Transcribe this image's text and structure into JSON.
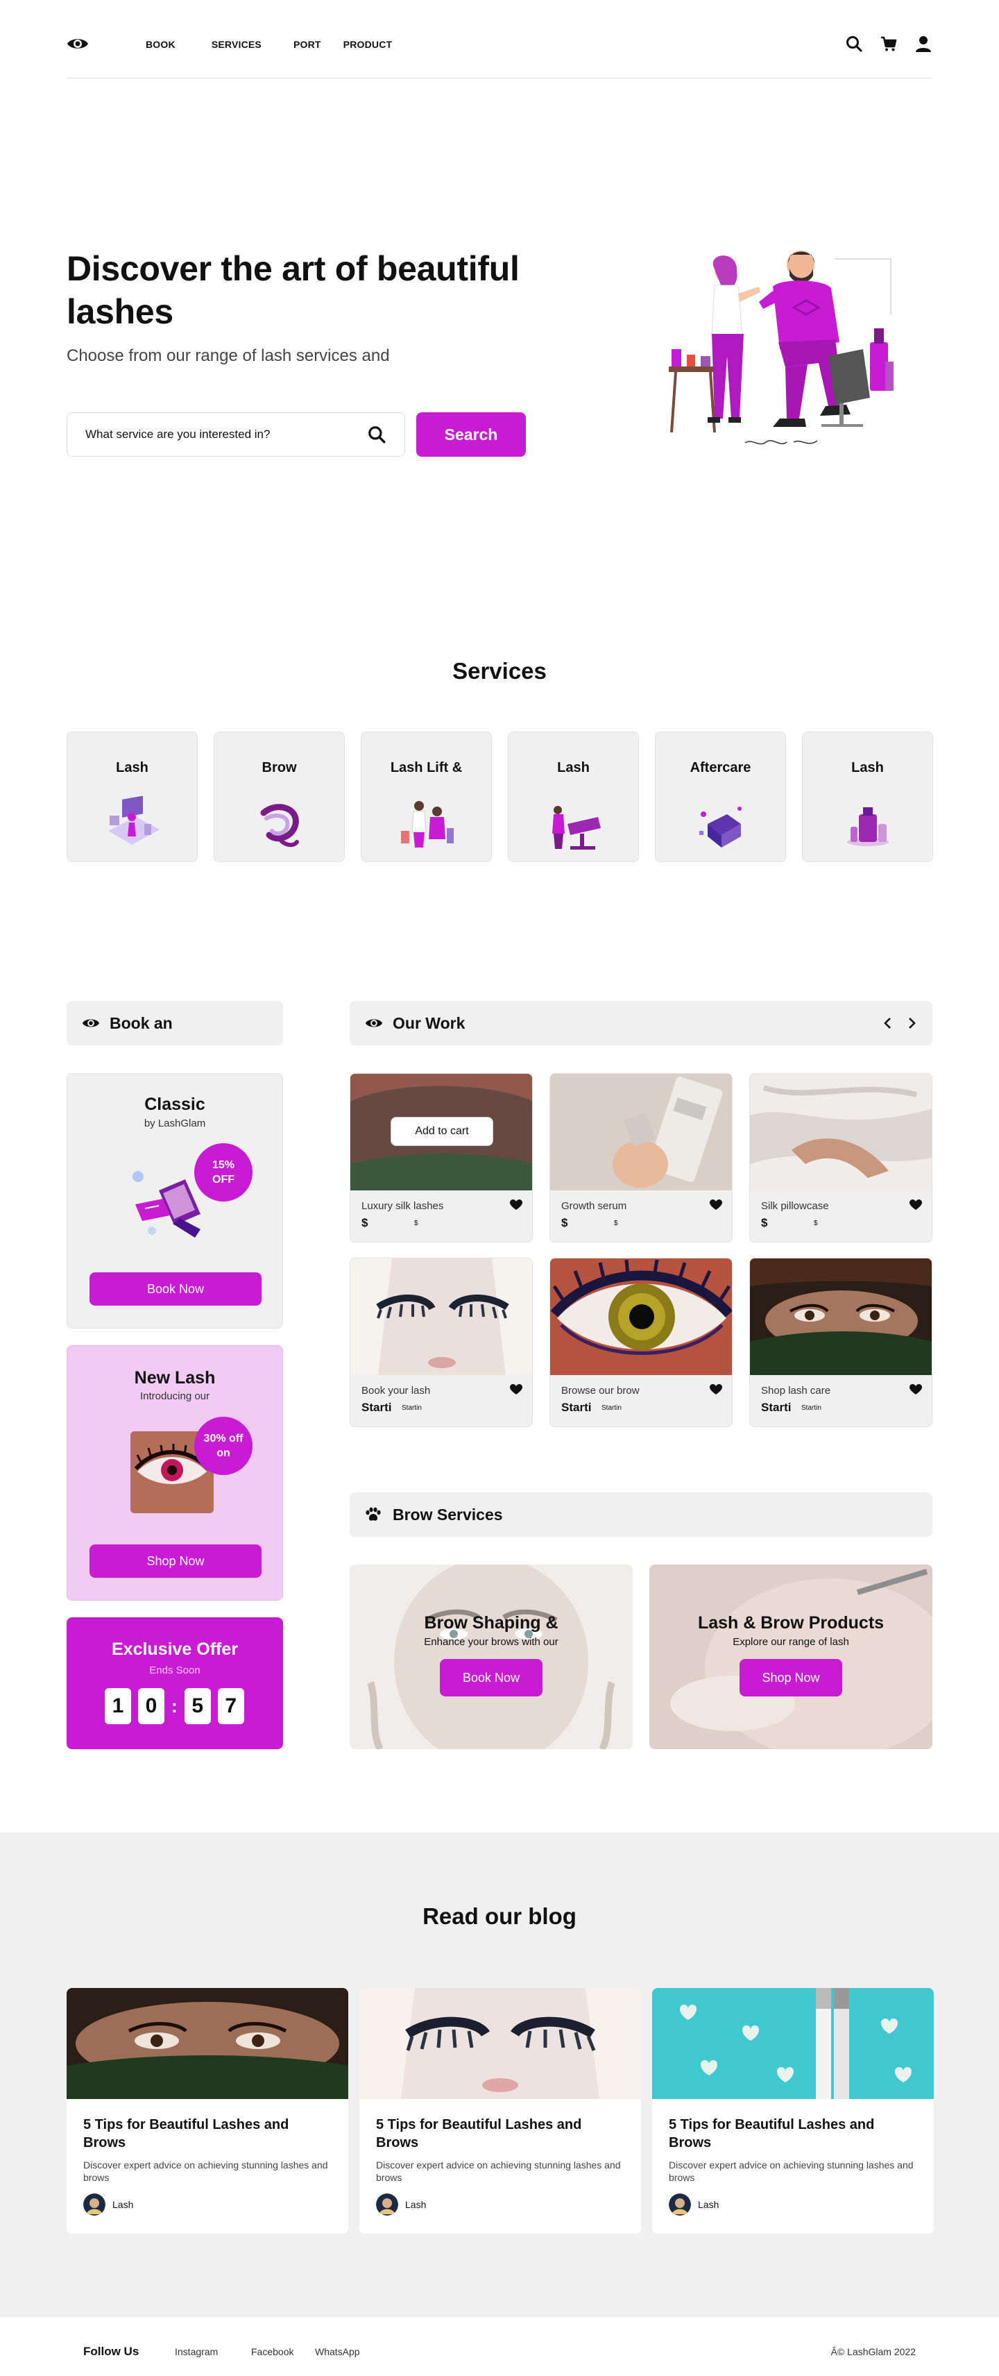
{
  "nav": {
    "items": [
      "BOOK",
      "SERVICES",
      "PORT",
      "PRODUCT"
    ]
  },
  "hero": {
    "title": "Discover the art of beautiful lashes",
    "subtitle": "Choose from our range of lash services and",
    "search_placeholder": "What service are you interested in?",
    "search_button": "Search"
  },
  "services": {
    "title": "Services",
    "items": [
      {
        "label": "Lash",
        "icon": "lash-laptop-illustration"
      },
      {
        "label": "Brow",
        "icon": "brow-swirl-illustration"
      },
      {
        "label": "Lash Lift &",
        "icon": "lash-lift-illustration"
      },
      {
        "label": "Lash",
        "icon": "lash-chair-illustration"
      },
      {
        "label": "Aftercare",
        "icon": "aftercare-illustration"
      },
      {
        "label": "Lash",
        "icon": "lash-product-illustration"
      }
    ]
  },
  "booking": {
    "title": "Book an",
    "classic": {
      "title": "Classic",
      "subtitle": "by LashGlam",
      "badge": "15% OFF",
      "button": "Book Now"
    },
    "new_lash": {
      "title": "New Lash",
      "subtitle": "Introducing our",
      "badge": "30% off on",
      "button": "Shop Now"
    },
    "offer": {
      "title": "Exclusive Offer",
      "subtitle": "Ends Soon",
      "digits": [
        "1",
        "0",
        "5",
        "7"
      ],
      "separator": ":"
    }
  },
  "work": {
    "title": "Our Work",
    "add_to_cart": "Add to cart",
    "items": [
      {
        "name": "Luxury silk lashes",
        "price": "$",
        "sub": "$"
      },
      {
        "name": "Growth serum",
        "price": "$",
        "sub": "$"
      },
      {
        "name": "Silk pillowcase",
        "price": "$",
        "sub": "$"
      },
      {
        "name": "Book your lash",
        "price": "Starti",
        "sub": "Startin"
      },
      {
        "name": "Browse our brow",
        "price": "Starti",
        "sub": "Startin"
      },
      {
        "name": "Shop lash care",
        "price": "Starti",
        "sub": "Startin"
      }
    ]
  },
  "brow": {
    "title": "Brow Services",
    "cards": [
      {
        "title": "Brow Shaping &",
        "subtitle": "Enhance your brows with our",
        "button": "Book Now"
      },
      {
        "title": "Lash & Brow Products",
        "subtitle": "Explore our range of lash",
        "button": "Shop Now"
      }
    ]
  },
  "blog": {
    "title": "Read our blog",
    "posts": [
      {
        "title": "5 Tips for Beautiful Lashes and Brows",
        "desc": "Discover expert advice on achieving stunning lashes and brows",
        "author": "Lash"
      },
      {
        "title": "5 Tips for Beautiful Lashes and Brows",
        "desc": "Discover expert advice on achieving stunning lashes and brows",
        "author": "Lash"
      },
      {
        "title": "5 Tips for Beautiful Lashes and Brows",
        "desc": "Discover expert advice on achieving stunning lashes and brows",
        "author": "Lash"
      }
    ]
  },
  "footer": {
    "follow": "Follow Us",
    "links": [
      "Instagram",
      "Facebook",
      "WhatsApp"
    ],
    "copyright": "Â© LashGlam 2022"
  },
  "colors": {
    "accent": "#c81cd4",
    "card_bg": "#f0f0f0",
    "pink_bg": "#f0cbf3"
  }
}
